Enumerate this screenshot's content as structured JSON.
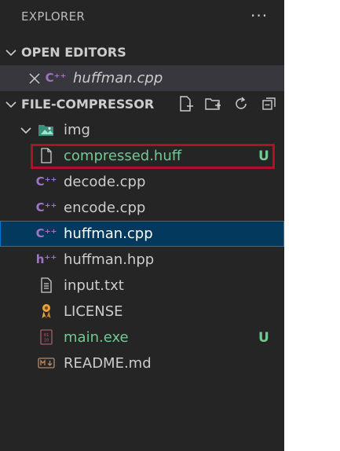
{
  "explorer": {
    "title": "EXPLORER",
    "more_icon": "ellipsis-icon"
  },
  "open_editors": {
    "title": "OPEN EDITORS",
    "file": {
      "name": "huffman.cpp",
      "icon": "cpp-file-icon"
    }
  },
  "project": {
    "title": "FILE-COMPRESSOR",
    "actions": [
      "new-file-icon",
      "new-folder-icon",
      "refresh-icon",
      "collapse-all-icon"
    ],
    "folder": {
      "name": "img"
    },
    "files": [
      {
        "name": "compressed.huff",
        "status": "U",
        "color": "#73c991",
        "icon": "file-icon"
      },
      {
        "name": "decode.cpp",
        "status": "",
        "color": "#cccccc",
        "icon": "cpp-file-icon"
      },
      {
        "name": "encode.cpp",
        "status": "",
        "color": "#cccccc",
        "icon": "cpp-file-icon"
      },
      {
        "name": "huffman.cpp",
        "status": "",
        "color": "#ffffff",
        "icon": "cpp-file-icon"
      },
      {
        "name": "huffman.hpp",
        "status": "",
        "color": "#cccccc",
        "icon": "hpp-file-icon"
      },
      {
        "name": "input.txt",
        "status": "",
        "color": "#cccccc",
        "icon": "text-file-icon"
      },
      {
        "name": "LICENSE",
        "status": "",
        "color": "#cccccc",
        "icon": "license-icon"
      },
      {
        "name": "main.exe",
        "status": "U",
        "color": "#73c991",
        "icon": "binary-file-icon"
      },
      {
        "name": "README.md",
        "status": "",
        "color": "#cccccc",
        "icon": "markdown-icon"
      }
    ]
  },
  "colors": {
    "sidebar_bg": "#252526",
    "selected_bg": "#04395e",
    "selected_border": "#0078d4",
    "highlight_box": "#b0102a",
    "untracked": "#73c991",
    "cpp": "#a074c4"
  }
}
